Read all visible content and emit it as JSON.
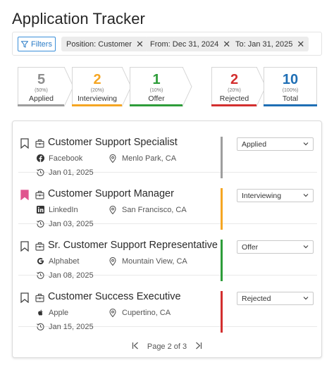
{
  "title": "Application Tracker",
  "filter_bar": {
    "filters_label": "Filters",
    "chips": [
      {
        "label": "Position: Customer"
      },
      {
        "label": "From: Dec 31, 2024"
      },
      {
        "label": "To: Jan 31, 2025"
      }
    ]
  },
  "stats": [
    {
      "count": "5",
      "percent": "(50%)",
      "label": "Applied",
      "color": "#9e9e9e"
    },
    {
      "count": "2",
      "percent": "(20%)",
      "label": "Interviewing",
      "color": "#f5a623"
    },
    {
      "count": "1",
      "percent": "(10%)",
      "label": "Offer",
      "color": "#2e9d3a"
    },
    {
      "count": "2",
      "percent": "(20%)",
      "label": "Rejected",
      "color": "#d32f2f"
    },
    {
      "count": "10",
      "percent": "(100%)",
      "label": "Total",
      "color": "#1f6fb5"
    }
  ],
  "applications": [
    {
      "title": "Customer Support Specialist",
      "source": "Facebook",
      "source_icon": "facebook-icon",
      "location": "Menlo Park, CA",
      "date": "Jan 01, 2025",
      "status": "Applied",
      "status_color": "#9e9e9e",
      "bookmarked": false
    },
    {
      "title": "Customer Support Manager",
      "source": "LinkedIn",
      "source_icon": "linkedin-icon",
      "location": "San Francisco, CA",
      "date": "Jan 03, 2025",
      "status": "Interviewing",
      "status_color": "#f5a623",
      "bookmarked": true
    },
    {
      "title": "Sr. Customer Support Representative",
      "source": "Alphabet",
      "source_icon": "google-icon",
      "location": "Mountain View, CA",
      "date": "Jan 08, 2025",
      "status": "Offer",
      "status_color": "#2e9d3a",
      "bookmarked": false
    },
    {
      "title": "Customer Success Executive",
      "source": "Apple",
      "source_icon": "apple-icon",
      "location": "Cupertino, CA",
      "date": "Jan 15, 2025",
      "status": "Rejected",
      "status_color": "#d32f2f",
      "bookmarked": false
    }
  ],
  "pagination": {
    "label": "Page 2 of 3"
  },
  "colors": {
    "accent": "#2a7cc7",
    "bookmark_active": "#e0558f"
  }
}
